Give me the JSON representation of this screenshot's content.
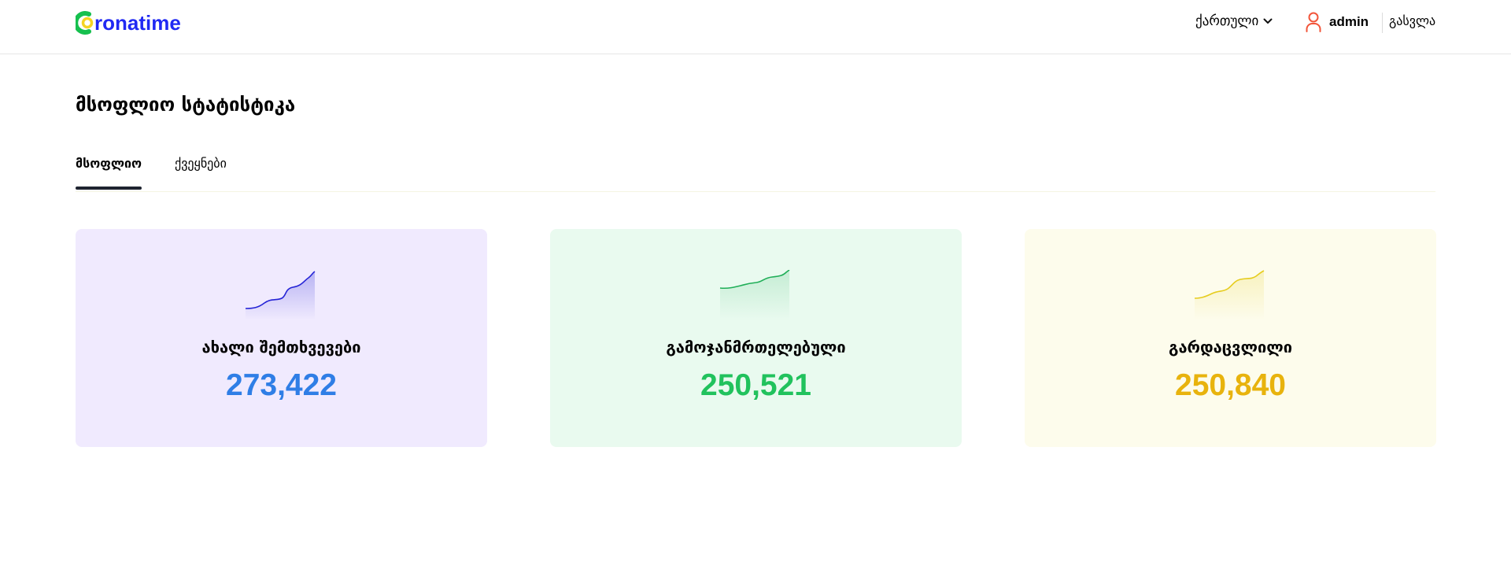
{
  "header": {
    "logo_text": "ronatime",
    "language": "ქართული",
    "user_name": "admin",
    "logout": "გასვლა"
  },
  "page": {
    "title": "მსოფლიო სტატისტიკა",
    "tabs": [
      "მსოფლიო",
      "ქვეყნები"
    ]
  },
  "stats": [
    {
      "label": "ახალი შემთხვევები",
      "value": "273,422",
      "value_color": "#2f7ee6",
      "line_color": "#2524d6",
      "bg": "#f0eafe"
    },
    {
      "label": "გამოჯანმრთელებული",
      "value": "250,521",
      "value_color": "#21c25d",
      "line_color": "#1fae57",
      "bg": "#e9faef"
    },
    {
      "label": "გარდაცვლილი",
      "value": "250,840",
      "value_color": "#e8b30d",
      "line_color": "#e6cc1d",
      "bg": "#fdfcec"
    }
  ],
  "colors": {
    "logo_text": "#2029f3",
    "user_icon": "#f2553a",
    "tab_underline": "#1f2430"
  },
  "icons": {
    "logo": "corona-c-logo",
    "chevron": "chevron-down-icon",
    "user": "user-icon"
  }
}
